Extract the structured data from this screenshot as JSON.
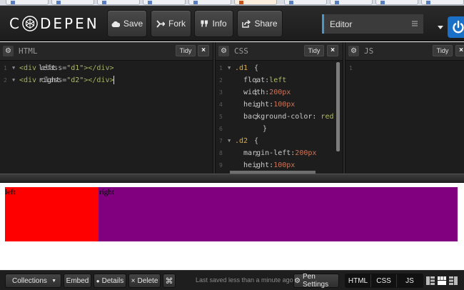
{
  "header": {
    "logo_text": "C DEPEN",
    "buttons": {
      "save": {
        "label": "Save",
        "icon": "cloud-icon"
      },
      "fork": {
        "label": "Fork",
        "icon": "fork-icon"
      },
      "info": {
        "label": "Info",
        "icon": "quote-icon"
      },
      "share": {
        "label": "Share",
        "icon": "share-icon"
      }
    },
    "layout_select": "Editor",
    "accent_color": "#4a98c9",
    "power_color": "#1a6fc6"
  },
  "editors": {
    "html": {
      "title": "HTML",
      "tidy": "Tidy",
      "close": "×",
      "lines": [
        {
          "num": "1",
          "parts": [
            [
              "tag",
              "<div "
            ],
            [
              "attr",
              "class="
            ],
            [
              "str",
              "\"d1\""
            ],
            [
              "tag",
              ">"
            ],
            [
              "txt",
              "left"
            ],
            [
              "tag",
              "</div>"
            ]
          ]
        },
        {
          "num": "2",
          "parts": [
            [
              "tag",
              "<div "
            ],
            [
              "attr",
              "class="
            ],
            [
              "str",
              "\"d2\""
            ],
            [
              "tag",
              ">"
            ],
            [
              "txt",
              "right"
            ],
            [
              "tag",
              "</div>"
            ]
          ]
        }
      ]
    },
    "css": {
      "title": "CSS",
      "tidy": "Tidy",
      "close": "×",
      "lines": [
        {
          "num": "1",
          "fold": true,
          "parts": [
            [
              "sel",
              ".d1"
            ],
            [
              "txt",
              "{"
            ]
          ]
        },
        {
          "num": "2",
          "parts": [
            [
              "prop",
              "  float:"
            ],
            [
              "val",
              "left"
            ],
            [
              "txt",
              ";"
            ]
          ]
        },
        {
          "num": "3",
          "parts": [
            [
              "prop",
              "  width:"
            ],
            [
              "num",
              "200px"
            ],
            [
              "txt",
              ";"
            ]
          ]
        },
        {
          "num": "4",
          "parts": [
            [
              "prop",
              "  height:"
            ],
            [
              "num",
              "100px"
            ],
            [
              "txt",
              ";"
            ]
          ]
        },
        {
          "num": "5",
          "parts": [
            [
              "prop",
              "  background-color: "
            ],
            [
              "val",
              "red"
            ],
            [
              "txt",
              ";"
            ]
          ]
        },
        {
          "num": "6",
          "parts": [
            [
              "txt",
              "  }"
            ]
          ]
        },
        {
          "num": "7",
          "fold": true,
          "parts": [
            [
              "sel",
              ".d2"
            ],
            [
              "txt",
              "{"
            ]
          ]
        },
        {
          "num": "8",
          "parts": [
            [
              "prop",
              "  margin-left:"
            ],
            [
              "num",
              "200px"
            ],
            [
              "txt",
              ";"
            ]
          ]
        },
        {
          "num": "9",
          "parts": [
            [
              "prop",
              "  height:"
            ],
            [
              "num",
              "100px"
            ],
            [
              "txt",
              ";"
            ]
          ]
        }
      ]
    },
    "js": {
      "title": "JS",
      "tidy": "Tidy",
      "close": "×",
      "lines": [
        {
          "num": "1",
          "parts": []
        }
      ]
    }
  },
  "preview": {
    "d1_text": "left",
    "d2_text": "right",
    "d1_color": "#ff0000",
    "d2_color": "#800080"
  },
  "footer": {
    "collections": "Collections",
    "embed": "Embed",
    "details": "Details",
    "delete": "Delete",
    "saved_text": "Last saved less than a minute ago",
    "pen_settings": "Pen Settings",
    "view_tabs": [
      "HTML",
      "CSS",
      "JS"
    ]
  }
}
